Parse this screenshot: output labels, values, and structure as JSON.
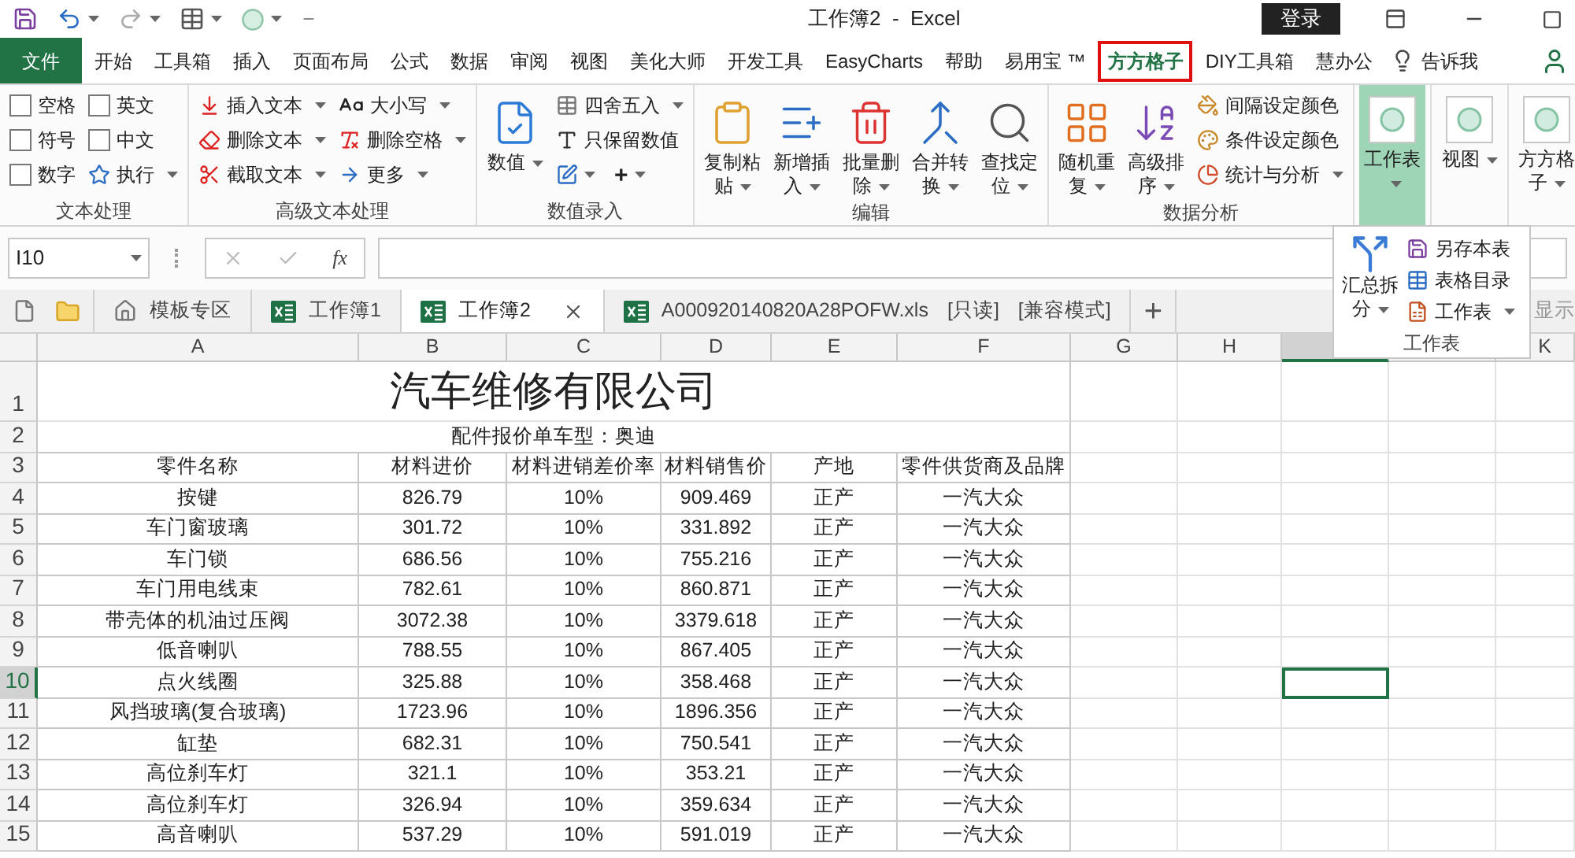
{
  "title_bar": {
    "title": "工作簿2  -  Excel",
    "login": "登录"
  },
  "menu_tabs": [
    {
      "label": "文件",
      "kind": "file",
      "selected": false
    },
    {
      "label": "开始",
      "kind": "tab",
      "selected": false
    },
    {
      "label": "工具箱",
      "kind": "tab",
      "selected": false
    },
    {
      "label": "插入",
      "kind": "tab",
      "selected": false
    },
    {
      "label": "页面布局",
      "kind": "tab",
      "selected": false
    },
    {
      "label": "公式",
      "kind": "tab",
      "selected": false
    },
    {
      "label": "数据",
      "kind": "tab",
      "selected": false
    },
    {
      "label": "审阅",
      "kind": "tab",
      "selected": false
    },
    {
      "label": "视图",
      "kind": "tab",
      "selected": false
    },
    {
      "label": "美化大师",
      "kind": "tab",
      "selected": false
    },
    {
      "label": "开发工具",
      "kind": "tab",
      "selected": false
    },
    {
      "label": "EasyCharts",
      "kind": "tab",
      "selected": false
    },
    {
      "label": "帮助",
      "kind": "tab",
      "selected": false
    },
    {
      "label": "易用宝 ™",
      "kind": "tab",
      "selected": false
    },
    {
      "label": "方方格子",
      "kind": "tab",
      "selected": true
    },
    {
      "label": "DIY工具箱",
      "kind": "tab",
      "selected": false
    },
    {
      "label": "慧办公",
      "kind": "tab",
      "selected": false
    },
    {
      "label": "告诉我",
      "kind": "tell",
      "selected": false
    }
  ],
  "ribbon": {
    "groups": [
      {
        "label": "文本处理",
        "items": [
          {
            "kind": "checkbox",
            "label": "空格",
            "checked": false
          },
          {
            "kind": "checkbox",
            "label": "符号",
            "checked": false
          },
          {
            "kind": "checkbox",
            "label": "数字",
            "checked": false
          },
          {
            "kind": "checkbox",
            "label": "英文",
            "checked": false
          },
          {
            "kind": "checkbox",
            "label": "中文",
            "checked": false
          },
          {
            "kind": "small",
            "label": "执行",
            "dropdown": true
          }
        ]
      },
      {
        "label": "高级文本处理",
        "items": [
          {
            "kind": "small",
            "label": "插入文本",
            "dropdown": true
          },
          {
            "kind": "small",
            "label": "删除文本",
            "dropdown": true
          },
          {
            "kind": "small",
            "label": "截取文本",
            "dropdown": true
          },
          {
            "kind": "small",
            "label": "大小写",
            "dropdown": true
          },
          {
            "kind": "small",
            "label": "删除空格",
            "dropdown": true
          },
          {
            "kind": "small",
            "label": "更多",
            "dropdown": true
          }
        ]
      },
      {
        "label": "数值录入",
        "items": [
          {
            "kind": "large",
            "label": "数值",
            "dropdown": true,
            "pressed": false
          },
          {
            "kind": "small",
            "label": "四舍五入",
            "dropdown": true
          },
          {
            "kind": "small",
            "label": "只保留数值",
            "dropdown": false
          },
          {
            "kind": "tools",
            "label": "+",
            "dropdown": true
          }
        ]
      },
      {
        "label": "编辑",
        "items": [
          {
            "kind": "large",
            "label": "复制粘贴",
            "dropdown": true,
            "pressed": false
          },
          {
            "kind": "large",
            "label": "新增插入",
            "dropdown": true,
            "pressed": false
          },
          {
            "kind": "large",
            "label": "批量删除",
            "dropdown": true,
            "pressed": false
          },
          {
            "kind": "large",
            "label": "合并转换",
            "dropdown": true,
            "pressed": false
          },
          {
            "kind": "large",
            "label": "查找定位",
            "dropdown": true,
            "pressed": false
          }
        ]
      },
      {
        "label": "数据分析",
        "items": [
          {
            "kind": "large",
            "label": "随机重复",
            "dropdown": true,
            "pressed": false
          },
          {
            "kind": "large",
            "label": "高级排序",
            "dropdown": true,
            "pressed": false
          },
          {
            "kind": "small",
            "label": "间隔设定颜色",
            "dropdown": false
          },
          {
            "kind": "small",
            "label": "条件设定颜色",
            "dropdown": false
          },
          {
            "kind": "small",
            "label": "统计与分析",
            "dropdown": true
          }
        ]
      },
      {
        "items": [
          {
            "kind": "large",
            "label": "工作表",
            "dropdown": true,
            "pressed": true
          }
        ]
      },
      {
        "items": [
          {
            "kind": "large",
            "label": "视图",
            "dropdown": true,
            "pressed": false
          }
        ]
      },
      {
        "items": [
          {
            "kind": "large",
            "label": "方方格子",
            "dropdown": true,
            "pressed": false
          }
        ]
      }
    ]
  },
  "popup": {
    "large": {
      "label": "汇总拆分",
      "dropdown": true
    },
    "items": [
      {
        "label": "另存本表",
        "dropdown": false
      },
      {
        "label": "表格目录",
        "dropdown": false
      },
      {
        "label": "工作表",
        "dropdown": true
      }
    ],
    "label": "工作表"
  },
  "formula_bar": {
    "name_box": "I10",
    "function_label": "fx"
  },
  "workbook_tabs": {
    "tabs": [
      {
        "label": "模板专区",
        "kind": "home",
        "selected": false
      },
      {
        "label": "工作簿1",
        "kind": "workbook",
        "selected": false
      },
      {
        "label": "工作簿2",
        "kind": "workbook",
        "selected": true
      },
      {
        "label": "A000920140820A28POFW.xls",
        "kind": "workbook",
        "selected": false,
        "flags": [
          "[只读]",
          "[兼容模式]"
        ]
      }
    ],
    "add": "+",
    "right_label": "显示"
  },
  "sheet": {
    "columns": [
      {
        "label": "A",
        "selected": false
      },
      {
        "label": "B",
        "selected": false
      },
      {
        "label": "C",
        "selected": false
      },
      {
        "label": "D",
        "selected": false
      },
      {
        "label": "E",
        "selected": false
      },
      {
        "label": "F",
        "selected": false
      },
      {
        "label": "G",
        "selected": false
      },
      {
        "label": "H",
        "selected": false
      },
      {
        "selected": true
      },
      {
        "selected": false
      },
      {
        "label": "K",
        "selected": false
      }
    ],
    "rows": [
      {
        "number": "1",
        "selected": false
      },
      {
        "number": "2",
        "selected": false
      },
      {
        "number": "3",
        "selected": false
      },
      {
        "number": "4",
        "selected": false
      },
      {
        "number": "5",
        "selected": false
      },
      {
        "number": "6",
        "selected": false
      },
      {
        "number": "7",
        "selected": false
      },
      {
        "number": "8",
        "selected": false
      },
      {
        "number": "9",
        "selected": false
      },
      {
        "number": "10",
        "selected": true
      },
      {
        "number": "11",
        "selected": false
      },
      {
        "number": "12",
        "selected": false
      },
      {
        "number": "13",
        "selected": false
      },
      {
        "number": "14",
        "selected": false
      },
      {
        "number": "15",
        "selected": false
      }
    ],
    "title": "汽车维修有限公司",
    "subtitle": "配件报价单车型：奥迪",
    "header": [
      "零件名称",
      "材料进价",
      "材料进销差价率",
      "材料销售价",
      "产地",
      "零件供货商及品牌"
    ],
    "data": [
      [
        "按键",
        "826.79",
        "10%",
        "909.469",
        "正产",
        "一汽大众"
      ],
      [
        "车门窗玻璃",
        "301.72",
        "10%",
        "331.892",
        "正产",
        "一汽大众"
      ],
      [
        "车门锁",
        "686.56",
        "10%",
        "755.216",
        "正产",
        "一汽大众"
      ],
      [
        "车门用电线束",
        "782.61",
        "10%",
        "860.871",
        "正产",
        "一汽大众"
      ],
      [
        "带壳体的机油过压阀",
        "3072.38",
        "10%",
        "3379.618",
        "正产",
        "一汽大众"
      ],
      [
        "低音喇叭",
        "788.55",
        "10%",
        "867.405",
        "正产",
        "一汽大众"
      ],
      [
        "点火线圈",
        "325.88",
        "10%",
        "358.468",
        "正产",
        "一汽大众"
      ],
      [
        "风挡玻璃(复合玻璃)",
        "1723.96",
        "10%",
        "1896.356",
        "正产",
        "一汽大众"
      ],
      [
        "缸垫",
        "682.31",
        "10%",
        "750.541",
        "正产",
        "一汽大众"
      ],
      [
        "高位刹车灯",
        "321.1",
        "10%",
        "353.21",
        "正产",
        "一汽大众"
      ],
      [
        "高位刹车灯",
        "326.94",
        "10%",
        "359.634",
        "正产",
        "一汽大众"
      ],
      [
        "高音喇叭",
        "537.29",
        "10%",
        "591.019",
        "正产",
        "一汽大众"
      ]
    ]
  }
}
